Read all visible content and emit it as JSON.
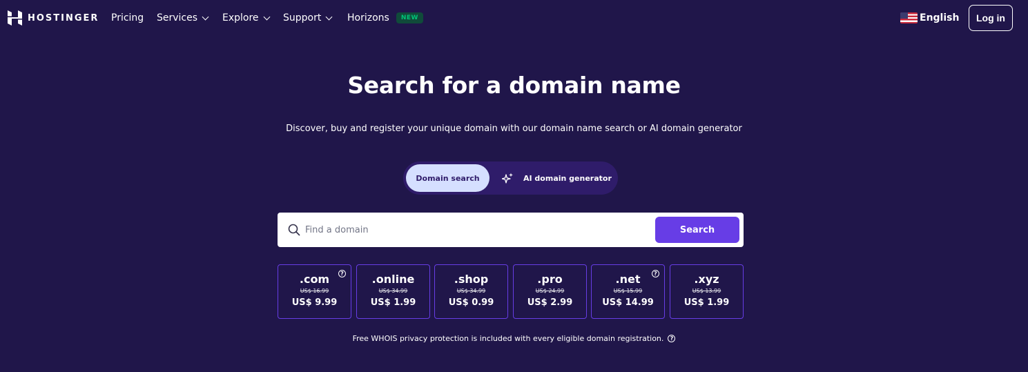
{
  "brand": {
    "name": "HOSTINGER",
    "logo_icon": "hostinger-h-logo"
  },
  "nav": {
    "items": [
      {
        "label": "Pricing",
        "has_dropdown": false
      },
      {
        "label": "Services",
        "has_dropdown": true
      },
      {
        "label": "Explore",
        "has_dropdown": true
      },
      {
        "label": "Support",
        "has_dropdown": true
      },
      {
        "label": "Horizons",
        "has_dropdown": false,
        "badge": "NEW"
      }
    ],
    "language": {
      "label": "English",
      "flag_icon": "us-flag-icon"
    },
    "login_label": "Log in"
  },
  "hero": {
    "title": "Search for a domain name",
    "subtitle": "Discover, buy and register your unique domain with our domain name search or AI domain generator"
  },
  "tabs": {
    "domain_search": "Domain search",
    "ai_generator": "AI domain generator",
    "active": "domain_search"
  },
  "search": {
    "placeholder": "Find a domain",
    "value": "",
    "button_label": "Search"
  },
  "tlds": [
    {
      "name": ".com",
      "old_price": "US$ 16.99",
      "new_price": "US$ 9.99",
      "has_help": true
    },
    {
      "name": ".online",
      "old_price": "US$ 34.99",
      "new_price": "US$ 1.99",
      "has_help": false
    },
    {
      "name": ".shop",
      "old_price": "US$ 34.99",
      "new_price": "US$ 0.99",
      "has_help": false
    },
    {
      "name": ".pro",
      "old_price": "US$ 24.99",
      "new_price": "US$ 2.99",
      "has_help": false
    },
    {
      "name": ".net",
      "old_price": "US$ 15.99",
      "new_price": "US$ 14.99",
      "has_help": true
    },
    {
      "name": ".xyz",
      "old_price": "US$ 13.99",
      "new_price": "US$ 1.99",
      "has_help": false
    }
  ],
  "footnote": "Free WHOIS privacy protection is included with every eligible domain registration.",
  "colors": {
    "background": "#20164a",
    "accent": "#673de6",
    "tab_active_bg": "#d5dfff",
    "tab_bar_bg": "#2f1c6a",
    "badge_bg": "#104b3a",
    "badge_text": "#00c478"
  }
}
